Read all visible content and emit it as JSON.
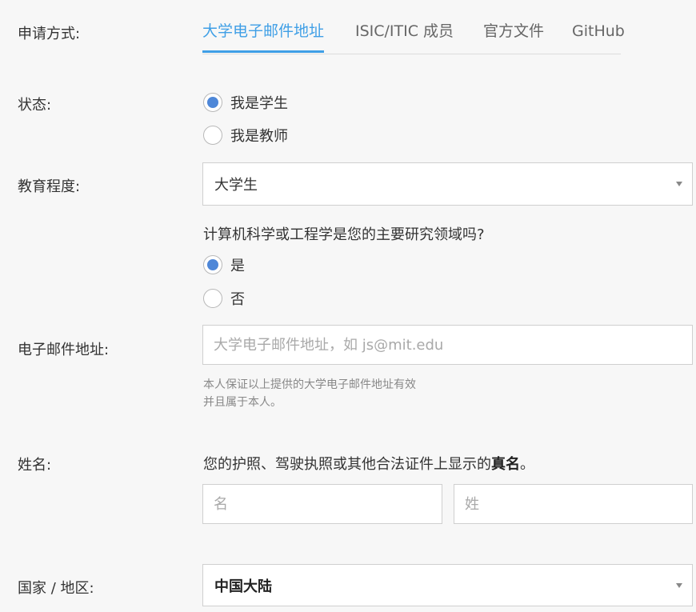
{
  "labels": {
    "method": "申请方式:",
    "status": "状态:",
    "education": "教育程度:",
    "email": "电子邮件地址:",
    "name": "姓名:",
    "country": "国家 / 地区:"
  },
  "tabs": [
    {
      "label": "大学电子邮件地址",
      "active": true
    },
    {
      "label": "ISIC/ITIC 成员",
      "active": false
    },
    {
      "label": "官方文件",
      "active": false
    },
    {
      "label": "GitHub",
      "active": false
    }
  ],
  "status_options": [
    {
      "label": "我是学生",
      "checked": true
    },
    {
      "label": "我是教师",
      "checked": false
    }
  ],
  "education_select": {
    "value": "大学生"
  },
  "cs_question": "计算机科学或工程学是您的主要研究领域吗?",
  "cs_options": [
    {
      "label": "是",
      "checked": true
    },
    {
      "label": "否",
      "checked": false
    }
  ],
  "email_field": {
    "placeholder": "大学电子邮件地址，如 js@mit.edu",
    "value": ""
  },
  "email_help": {
    "line1": "本人保证以上提供的大学电子邮件地址有效",
    "line2": "并且属于本人。"
  },
  "name_hint": {
    "text": "您的护照、驾驶执照或其他合法证件上显示的",
    "bold": "真名",
    "suffix": "。"
  },
  "first_name_field": {
    "placeholder": "名"
  },
  "last_name_field": {
    "placeholder": "姓"
  },
  "country_select": {
    "value": "中国大陆"
  },
  "colors": {
    "accent": "#3f9fe6",
    "radio_checked": "#4e87d8",
    "background": "#f7f7f7"
  }
}
